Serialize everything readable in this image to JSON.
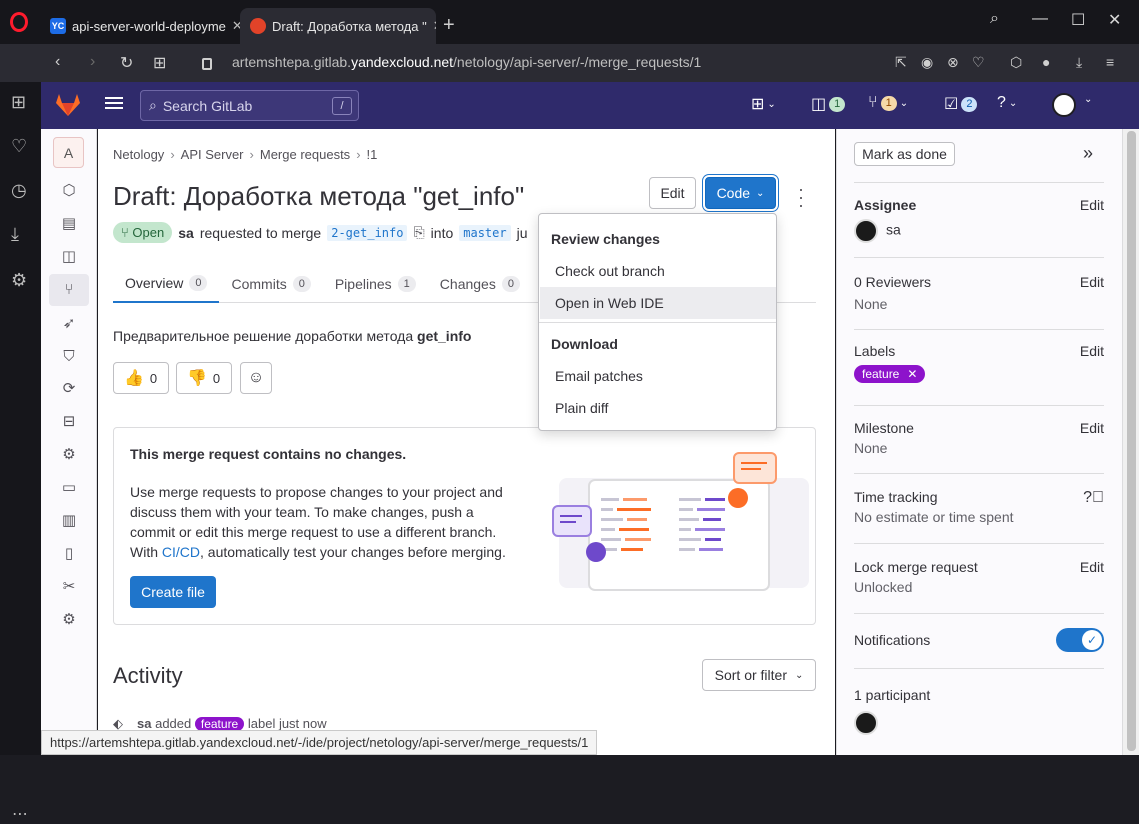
{
  "browser": {
    "tabs": [
      {
        "title": "api-server-world-deployme",
        "favicon": "YC",
        "favicon_color": "#1d6ce6"
      },
      {
        "title": "Draft: Доработка метода \"",
        "favicon": "gitlab",
        "active": true
      }
    ],
    "new_tab": "+",
    "url_prefix": "artemshtepa.gitlab.",
    "url_domain": "yandexcloud.net",
    "url_path": "/netology/api-server/-/merge_requests/1",
    "status_url": "https://artemshtepa.gitlab.yandexcloud.net/-/ide/project/netology/api-server/merge_requests/1"
  },
  "header": {
    "search_placeholder": "Search GitLab",
    "search_shortcut": "/",
    "issues_count": "1",
    "mr_count": "1",
    "todo_count": "2"
  },
  "project": {
    "avatar_letter": "A"
  },
  "breadcrumb": [
    "Netology",
    "API Server",
    "Merge requests",
    "!1"
  ],
  "mr": {
    "title": "Draft: Доработка метода \"get_info\"",
    "edit_label": "Edit",
    "code_label": "Code",
    "status": "Open",
    "author": "sa",
    "requested_text": "requested to merge",
    "source_branch": "2-get_info",
    "into_text": "into",
    "target_branch": "master",
    "trailing": "ju",
    "description_prefix": "Предварительное решение доработки метода",
    "description_bold": "get_info",
    "thumbs_up": "0",
    "thumbs_down": "0"
  },
  "tabs": [
    {
      "label": "Overview",
      "count": "0"
    },
    {
      "label": "Commits",
      "count": "0"
    },
    {
      "label": "Pipelines",
      "count": "1"
    },
    {
      "label": "Changes",
      "count": "0"
    }
  ],
  "empty_state": {
    "title": "This merge request contains no changes.",
    "text_1": "Use merge requests to propose changes to your project and discuss them with your team. To make changes, push a commit or edit this merge request to use a different branch. With",
    "link": "CI/CD",
    "text_2": ", automatically test your changes before merging.",
    "button": "Create file"
  },
  "activity": {
    "title": "Activity",
    "sort_label": "Sort or filter",
    "line_author": "sa",
    "line_added": "added",
    "line_label": "feature",
    "line_rest": "label just now"
  },
  "code_dropdown": {
    "review_header": "Review changes",
    "checkout": "Check out branch",
    "web_ide": "Open in Web IDE",
    "download_header": "Download",
    "email_patches": "Email patches",
    "plain_diff": "Plain diff"
  },
  "sidebar": {
    "mark_done": "Mark as done",
    "assignee_title": "Assignee",
    "assignee_name": "sa",
    "reviewers_title": "0 Reviewers",
    "reviewers_value": "None",
    "labels_title": "Labels",
    "label_name": "feature",
    "milestone_title": "Milestone",
    "milestone_value": "None",
    "time_title": "Time tracking",
    "time_value": "No estimate or time spent",
    "lock_title": "Lock merge request",
    "lock_value": "Unlocked",
    "notifications_title": "Notifications",
    "participants_title": "1 participant",
    "edit_label": "Edit"
  },
  "colors": {
    "header_bg": "#2f2a6b",
    "primary": "#1f75cb",
    "label": "#8d13cb",
    "open_badge": "#c3e6cd"
  }
}
